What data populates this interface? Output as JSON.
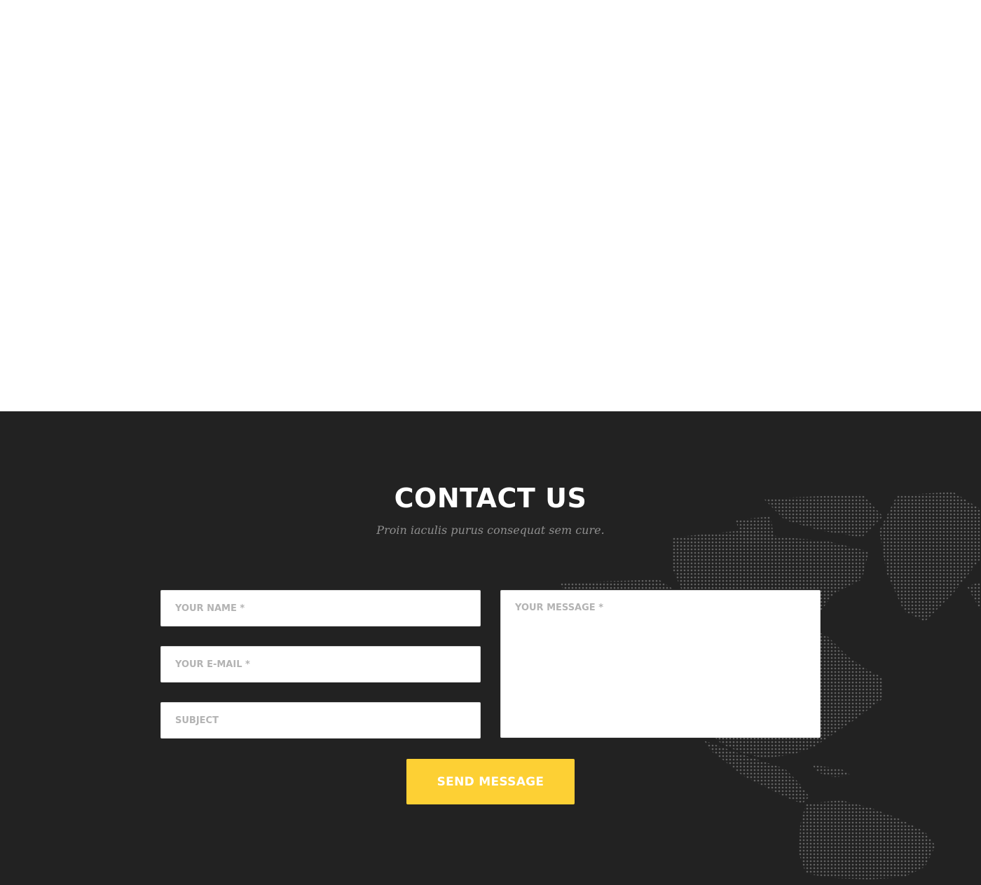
{
  "contact": {
    "title": "CONTACT US",
    "subtitle": "Proin iaculis purus consequat sem cure.",
    "fields": {
      "name_placeholder": "YOUR NAME *",
      "email_placeholder": "YOUR E-MAIL *",
      "subject_placeholder": "SUBJECT",
      "message_placeholder": "YOUR MESSAGE *"
    },
    "send_label": "SEND MESSAGE",
    "background_icon": "world-map-dots"
  },
  "colors": {
    "section_background": "#222222",
    "accent": "#fdd034",
    "title": "#ffffff",
    "subtitle": "#8f8f8f",
    "map_dots": "#6a6a6a"
  }
}
